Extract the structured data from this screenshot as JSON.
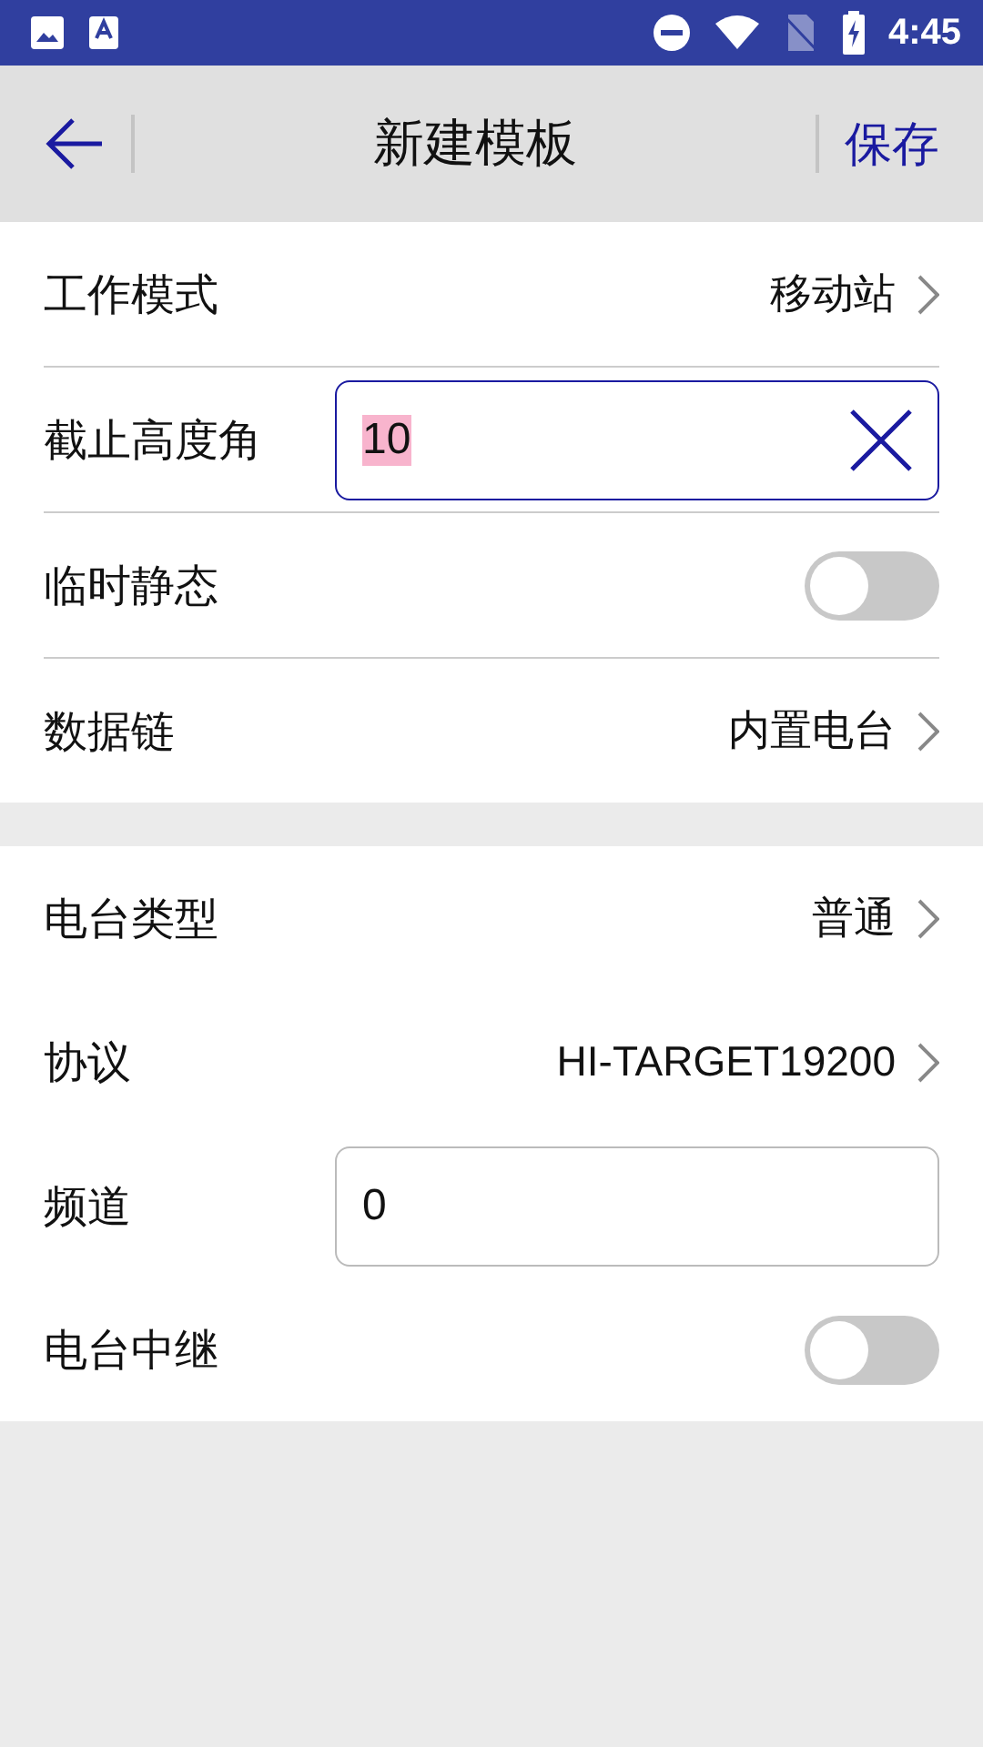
{
  "status_bar": {
    "time": "4:45"
  },
  "header": {
    "title": "新建模板",
    "save": "保存"
  },
  "sections": [
    {
      "dividers": true,
      "rows": [
        {
          "kind": "select",
          "label": "工作模式",
          "value": "移动站"
        },
        {
          "kind": "input",
          "label": "截止高度角",
          "value": "10",
          "focused": true
        },
        {
          "kind": "toggle",
          "label": "临时静态",
          "on": false
        },
        {
          "kind": "select",
          "label": "数据链",
          "value": "内置电台"
        }
      ]
    },
    {
      "dividers": false,
      "rows": [
        {
          "kind": "select",
          "label": "电台类型",
          "value": "普通"
        },
        {
          "kind": "select",
          "label": "协议",
          "value": "HI-TARGET19200"
        },
        {
          "kind": "input",
          "label": "频道",
          "value": "0",
          "focused": false
        },
        {
          "kind": "toggle",
          "label": "电台中继",
          "on": false
        }
      ]
    }
  ]
}
